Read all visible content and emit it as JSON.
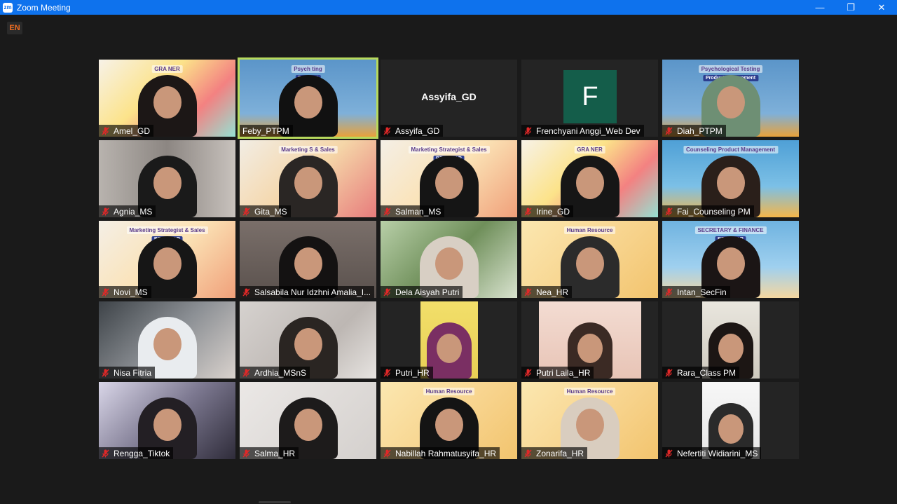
{
  "window": {
    "title": "Zoom Meeting",
    "app_icon_text": "zm",
    "controls": {
      "minimize": "—",
      "restore": "❐",
      "close": "✕"
    }
  },
  "language_badge": "EN",
  "colors": {
    "titlebar": "#0e72ed",
    "active_speaker_border": "#b7d95c",
    "mute_icon": "#e02828",
    "avatar_bg": "#145d4a"
  },
  "participants": [
    {
      "name": "Amel_GD",
      "muted": true,
      "kind": "video",
      "bg": "linear-gradient(135deg,#f7f2e8 0%,#fce38a 40%,#f38181 70%,#95e1d3 100%)",
      "banner": "GRA    NER",
      "banner_sub": "",
      "hair": "#1c1716"
    },
    {
      "name": "Feby_PTPM",
      "muted": false,
      "kind": "video",
      "active": true,
      "bg": "linear-gradient(180deg,#5b95c9 0%,#7eb0d9 70%,#e9a23b 100%)",
      "banner": "Psych    ting",
      "banner_sub": "Prod    ent",
      "hair": "#111"
    },
    {
      "name": "Assyifa_GD",
      "muted": true,
      "kind": "name"
    },
    {
      "name": "Frenchyani Anggi_Web Dev",
      "muted": true,
      "kind": "avatar",
      "letter": "F"
    },
    {
      "name": "Diah_PTPM",
      "muted": true,
      "kind": "video",
      "bg": "linear-gradient(180deg,#5b95c9 0%,#7eb0d9 70%,#e9a23b 100%)",
      "banner": "Psychological Testing",
      "banner_sub": "Product Management",
      "hair": "#6e8f74"
    },
    {
      "name": "Agnia_MS",
      "muted": true,
      "kind": "video",
      "bg": "linear-gradient(90deg,#b8b3ae 0%,#8c8682 50%,#c8c2bd 100%)",
      "banner": "",
      "banner_sub": "",
      "hair": "#1a1a1a"
    },
    {
      "name": "Gita_MS",
      "muted": true,
      "kind": "video",
      "bg": "linear-gradient(135deg,#f2ede4 0%,#f5d6a8 50%,#e77c7c 100%)",
      "banner": "Marketing S     & Sales",
      "banner_sub": "BE",
      "hair": "#2a2624"
    },
    {
      "name": "Salman_MS",
      "muted": true,
      "kind": "video",
      "bg": "linear-gradient(135deg,#f4efe6 0%,#fbe2b5 50%,#f0a07a 100%)",
      "banner": "Marketing Strategist & Sales",
      "banner_sub": "BERBINAR",
      "hair": "#151515"
    },
    {
      "name": "Irine_GD",
      "muted": true,
      "kind": "video",
      "bg": "linear-gradient(135deg,#f7f2e8 0%,#fce38a 40%,#f38181 70%,#95e1d3 100%)",
      "banner": "GRA    NER",
      "banner_sub": "",
      "hair": "#161616"
    },
    {
      "name": "Fai_Counseling PM",
      "muted": true,
      "kind": "video",
      "bg": "linear-gradient(180deg,#4fa0d6 0%,#7cc0e6 60%,#f4b64a 100%)",
      "banner": "Counseling Product Management",
      "banner_sub": "",
      "hair": "#2a1f1a"
    },
    {
      "name": "Novi_MS",
      "muted": true,
      "kind": "video",
      "bg": "linear-gradient(135deg,#f4efe6 0%,#fbe2b5 50%,#f0a07a 100%)",
      "banner": "Marketing Strategist & Sales",
      "banner_sub": "BERBINAR",
      "hair": "#161616"
    },
    {
      "name": "Salsabila Nur Idzhni Amalia_I...",
      "muted": true,
      "kind": "video",
      "bg": "linear-gradient(180deg,#7a6f6a 0%,#5a514d 100%)",
      "banner": "",
      "banner_sub": "",
      "hair": "#141212"
    },
    {
      "name": "Dela Aisyah Putri",
      "muted": true,
      "kind": "video",
      "bg": "linear-gradient(135deg,#b8cfa8 0%,#6f8f5a 50%,#d9e3cf 100%)",
      "banner": "",
      "banner_sub": "",
      "hair": "#d8cfc4"
    },
    {
      "name": "Nea_HR",
      "muted": true,
      "kind": "video",
      "bg": "linear-gradient(135deg,#fbe7b0 0%,#f7d28a 60%,#f2c46e 100%)",
      "banner": "Human Resource",
      "banner_sub": "",
      "hair": "#2b2b2b"
    },
    {
      "name": "Intan_SecFin",
      "muted": true,
      "kind": "video",
      "bg": "linear-gradient(180deg,#6fb3e0 0%,#9fd0ef 60%,#f5d7a0 100%)",
      "banner": "SECRETARY & FINANCE",
      "banner_sub": "BERBINAR",
      "hair": "#1b1515"
    },
    {
      "name": "Nisa Fitria",
      "muted": true,
      "kind": "video",
      "bg": "linear-gradient(135deg,#3e4348 0%,#8b8f94 50%,#d9d2cd 100%)",
      "banner": "",
      "banner_sub": "",
      "hair": "#e9ecef"
    },
    {
      "name": "Ardhia_MSnS",
      "muted": true,
      "kind": "video",
      "bg": "linear-gradient(135deg,#d6d2cf 0%,#bdb7b3 60%,#e7e4e1 100%)",
      "banner": "",
      "banner_sub": "",
      "hair": "#2a2522"
    },
    {
      "name": "Putri_HR",
      "muted": true,
      "kind": "pillar",
      "bg": "linear-gradient(180deg,#f2df6a 0%,#e8cf55 100%)",
      "banner": "",
      "banner_sub": "",
      "hair": "#7a2f63"
    },
    {
      "name": "Putri Laila_HR",
      "muted": true,
      "kind": "pillar-wide",
      "bg": "linear-gradient(180deg,#f3dcd2 0%,#e8c4b6 100%)",
      "banner": "",
      "banner_sub": "",
      "hair": "#3b2a24"
    },
    {
      "name": "Rara_Class PM",
      "muted": true,
      "kind": "pillar",
      "bg": "linear-gradient(180deg,#e9e6de 0%,#cfcabf 100%)",
      "banner": "",
      "banner_sub": "",
      "hair": "#1c1614"
    },
    {
      "name": "Rengga_Tiktok",
      "muted": true,
      "kind": "video",
      "bg": "linear-gradient(135deg,#d9d6e8 0%,#7c7890 50%,#2f2c3a 100%)",
      "banner": "",
      "banner_sub": "",
      "hair": "#231f24"
    },
    {
      "name": "Salma_HR",
      "muted": true,
      "kind": "video",
      "bg": "linear-gradient(135deg,#ebe8e6 0%,#d4d0cd 100%)",
      "banner": "",
      "banner_sub": "",
      "hair": "#1d1b1b"
    },
    {
      "name": "Nabillah Rahmatusyifa_HR",
      "muted": true,
      "kind": "video",
      "bg": "linear-gradient(135deg,#fbe7b0 0%,#f7d28a 60%,#f2c46e 100%)",
      "banner": "Human Resource",
      "banner_sub": "",
      "hair": "#141414"
    },
    {
      "name": "Zonarifa_HR",
      "muted": true,
      "kind": "video",
      "bg": "linear-gradient(135deg,#fbe7b0 0%,#f7d28a 60%,#f2c46e 100%)",
      "banner": "Human Resource",
      "banner_sub": "",
      "hair": "#d9cdbf"
    },
    {
      "name": "Nefertiti Widiarini_MS",
      "muted": true,
      "kind": "pillar",
      "bg": "linear-gradient(180deg,#f7f7f7 0%,#e6e6e6 100%)",
      "banner": "",
      "banner_sub": "",
      "hair": "#2a2a2a"
    }
  ]
}
